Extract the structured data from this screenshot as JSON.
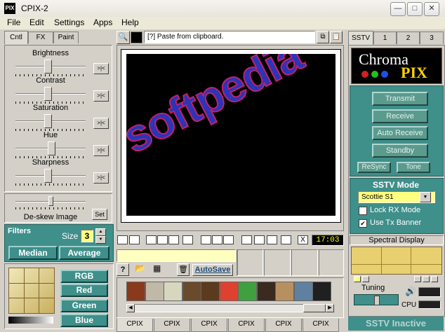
{
  "window": {
    "title": "CPIX-2",
    "app_icon": "PIX",
    "minimize_glyph": "—",
    "maximize_glyph": "□",
    "close_glyph": "✕"
  },
  "menu": [
    "File",
    "Edit",
    "Settings",
    "Apps",
    "Help"
  ],
  "left_tabs": [
    "Cntl",
    "FX",
    "Paint"
  ],
  "sliders": [
    {
      "label": "Brightness",
      "level": 0.45
    },
    {
      "label": "Contrast",
      "level": 0.45
    },
    {
      "label": "Saturation",
      "level": 0.45
    },
    {
      "label": "Hue",
      "level": 0.5
    },
    {
      "label": "Sharpness",
      "level": 0.45
    }
  ],
  "reset_glyph": ">|<",
  "deskew": {
    "label": "De-skew Image",
    "set_label": "Set",
    "level": 0.5
  },
  "filters": {
    "title": "Filters",
    "size_label": "Size",
    "size_value": "3",
    "median_label": "Median",
    "average_label": "Average"
  },
  "colors": {
    "rgb": "RGB",
    "red": "Red",
    "green": "Green",
    "blue": "Blue",
    "accent_teal": "#3f8f8a"
  },
  "clipboard_hint": "[?] Paste from clipboard.",
  "watermark": "softpedia",
  "time": "17:03",
  "autosave": "AutoSave",
  "bottom_tabs": [
    "CPIX",
    "CPIX",
    "CPIX",
    "CPIX",
    "CPIX",
    "CPIX"
  ],
  "right_tabs": [
    "SSTV",
    "1",
    "2",
    "3"
  ],
  "logo": {
    "text_chroma": "Chroma",
    "text_pix": "PIX"
  },
  "sstv_buttons": [
    "Transmit",
    "Receive",
    "Auto Receive",
    "Standby"
  ],
  "resync_label": "ReSync",
  "tone_label": "Tone",
  "sstv_mode": {
    "title": "SSTV Mode",
    "selected": "Scottie S1",
    "lock_rx": "Lock RX Mode",
    "lock_rx_checked": false,
    "use_tx_banner": "Use Tx Banner",
    "use_tx_banner_checked": true
  },
  "spectral": {
    "title": "Spectral Display"
  },
  "tuning": {
    "label": "Tuning",
    "cpu_label": "CPU"
  },
  "status": "SSTV Inactive",
  "thumbnail_colors": [
    "#8a3a1c",
    "#c0b8a8",
    "#d7d7c0",
    "#6a4a2a",
    "#5c3a1e",
    "#e04030",
    "#40a040",
    "#3a2a20",
    "#b89060",
    "#6080a0",
    "#202020"
  ]
}
